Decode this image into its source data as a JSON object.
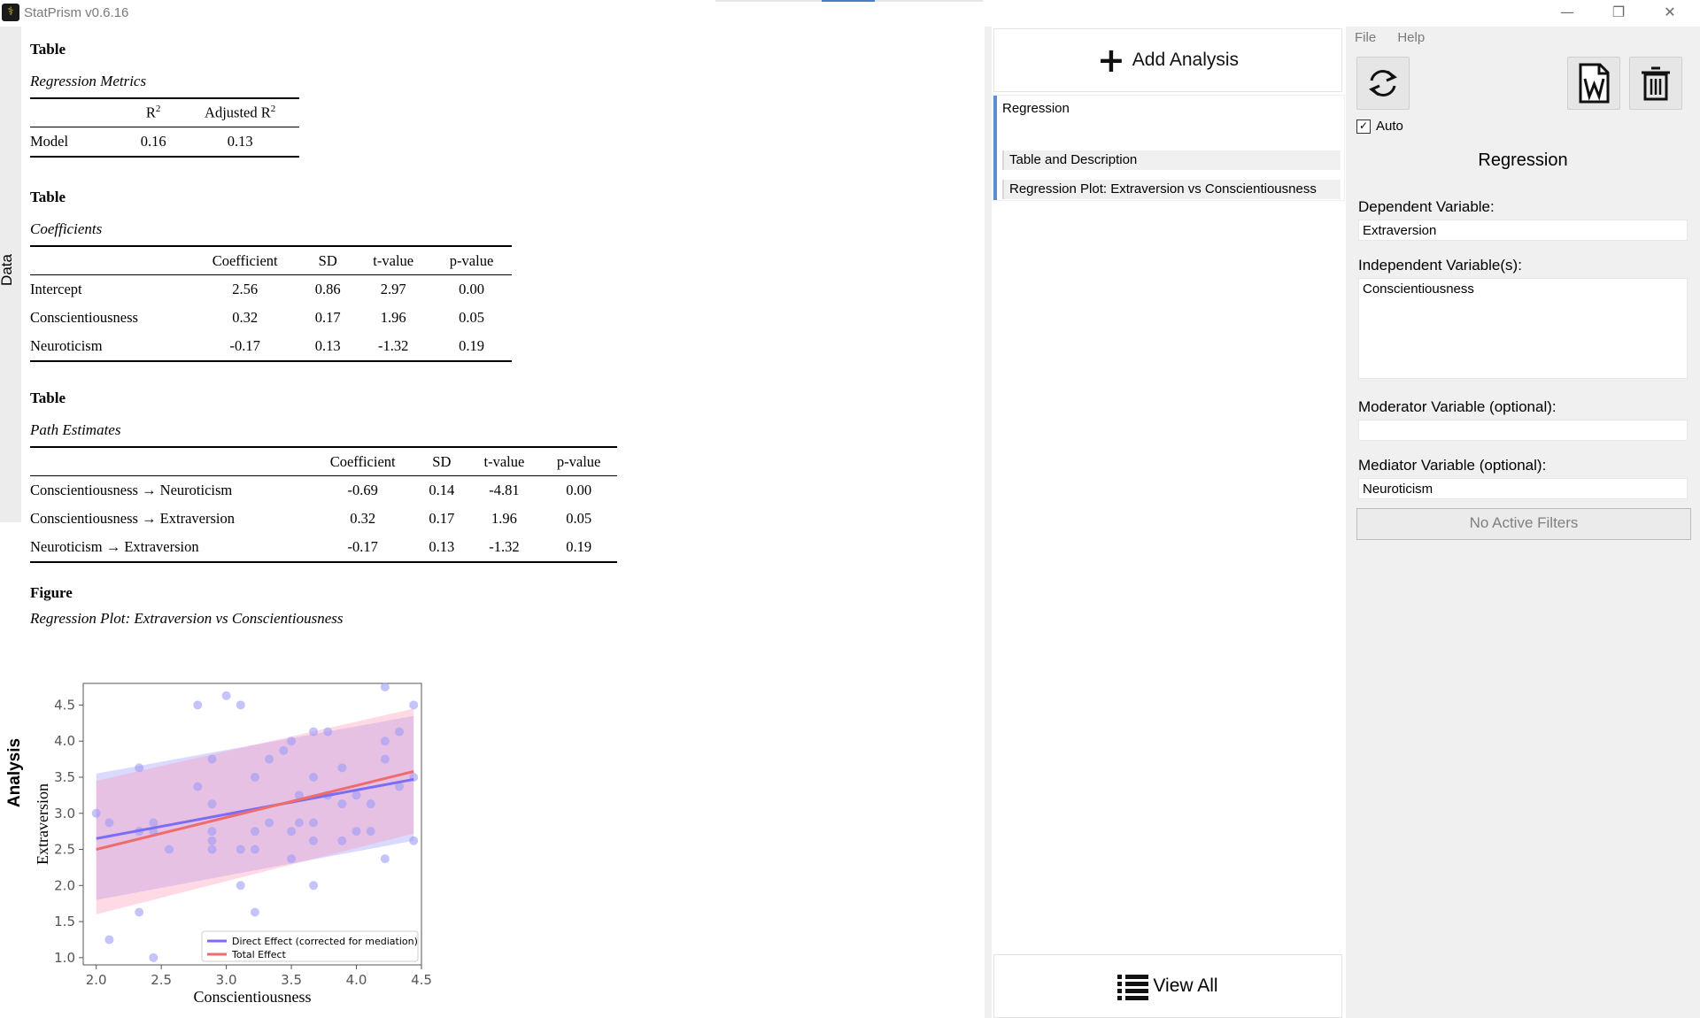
{
  "window": {
    "title": "StatPrism v0.6.16",
    "controls": {
      "minimize": "—",
      "restore": "❐",
      "close": "✕"
    },
    "progress_fraction": 0.2
  },
  "side_tabs": {
    "data": "Data",
    "analysis": "Analysis"
  },
  "report": {
    "table1": {
      "heading": "Table",
      "caption": "Regression Metrics",
      "row_label": "Model",
      "r2": "0.16",
      "adj_r2": "0.13",
      "col_r": "R",
      "col_adj": "Adjusted R",
      "sup": "2"
    },
    "table2": {
      "heading": "Table",
      "caption": "Coefficients",
      "columns": [
        "",
        "Coefficient",
        "SD",
        "t-value",
        "p-value"
      ],
      "rows": [
        [
          "Intercept",
          "2.56",
          "0.86",
          "2.97",
          "0.00"
        ],
        [
          "Conscientiousness",
          "0.32",
          "0.17",
          "1.96",
          "0.05"
        ],
        [
          "Neuroticism",
          "-0.17",
          "0.13",
          "-1.32",
          "0.19"
        ]
      ]
    },
    "table3": {
      "heading": "Table",
      "caption": "Path Estimates",
      "columns": [
        "",
        "Coefficient",
        "SD",
        "t-value",
        "p-value"
      ],
      "rows": [
        [
          "Conscientiousness → Neuroticism",
          "-0.69",
          "0.14",
          "-4.81",
          "0.00"
        ],
        [
          "Conscientiousness → Extraversion",
          "0.32",
          "0.17",
          "1.96",
          "0.05"
        ],
        [
          "Neuroticism → Extraversion",
          "-0.17",
          "0.13",
          "-1.32",
          "0.19"
        ]
      ]
    },
    "figure": {
      "heading": "Figure",
      "caption": "Regression Plot: Extraversion vs Conscientiousness"
    }
  },
  "chart_data": {
    "type": "scatter",
    "xlabel": "Conscientiousness",
    "ylabel": "Extraversion",
    "xlim": [
      1.9,
      4.5
    ],
    "ylim": [
      0.9,
      4.8
    ],
    "xticks": [
      "2.0",
      "2.5",
      "3.0",
      "3.5",
      "4.0",
      "4.5"
    ],
    "yticks": [
      "1.0",
      "1.5",
      "2.0",
      "2.5",
      "3.0",
      "3.5",
      "4.0",
      "4.5"
    ],
    "grid": false,
    "legend_position": "bottom-right",
    "points": [
      [
        2.0,
        3.0
      ],
      [
        2.1,
        2.87
      ],
      [
        2.1,
        1.25
      ],
      [
        2.33,
        3.63
      ],
      [
        2.33,
        2.75
      ],
      [
        2.33,
        1.63
      ],
      [
        2.44,
        2.87
      ],
      [
        2.44,
        2.75
      ],
      [
        2.44,
        1.0
      ],
      [
        2.56,
        2.5
      ],
      [
        2.78,
        3.37
      ],
      [
        2.78,
        4.5
      ],
      [
        2.89,
        3.75
      ],
      [
        2.89,
        3.13
      ],
      [
        2.89,
        2.75
      ],
      [
        2.89,
        2.62
      ],
      [
        2.89,
        2.5
      ],
      [
        3.0,
        4.63
      ],
      [
        3.11,
        4.5
      ],
      [
        3.11,
        2.5
      ],
      [
        3.11,
        2.0
      ],
      [
        3.22,
        3.5
      ],
      [
        3.22,
        2.75
      ],
      [
        3.22,
        2.5
      ],
      [
        3.22,
        1.63
      ],
      [
        3.33,
        3.75
      ],
      [
        3.33,
        2.87
      ],
      [
        3.44,
        3.87
      ],
      [
        3.5,
        4.0
      ],
      [
        3.5,
        2.75
      ],
      [
        3.5,
        2.37
      ],
      [
        3.56,
        3.25
      ],
      [
        3.56,
        2.87
      ],
      [
        3.67,
        4.13
      ],
      [
        3.67,
        3.5
      ],
      [
        3.67,
        2.87
      ],
      [
        3.67,
        2.62
      ],
      [
        3.67,
        2.0
      ],
      [
        3.78,
        4.13
      ],
      [
        3.78,
        3.25
      ],
      [
        3.89,
        3.63
      ],
      [
        3.89,
        3.13
      ],
      [
        3.89,
        2.62
      ],
      [
        4.0,
        3.25
      ],
      [
        4.0,
        2.75
      ],
      [
        4.11,
        3.13
      ],
      [
        4.11,
        2.75
      ],
      [
        4.22,
        4.75
      ],
      [
        4.22,
        4.0
      ],
      [
        4.22,
        3.75
      ],
      [
        4.22,
        2.37
      ],
      [
        4.33,
        4.13
      ],
      [
        4.33,
        3.37
      ],
      [
        4.44,
        4.5
      ],
      [
        4.44,
        3.5
      ],
      [
        4.44,
        2.62
      ]
    ],
    "series": [
      {
        "name": "Direct Effect (corrected for mediation)",
        "color": "#7b6cf6",
        "x": [
          2.0,
          4.44
        ],
        "y": [
          2.65,
          3.47
        ],
        "band_lower": [
          1.8,
          2.62
        ],
        "band_upper": [
          3.55,
          4.35
        ]
      },
      {
        "name": "Total Effect",
        "color": "#f06b6b",
        "x": [
          2.0,
          4.44
        ],
        "y": [
          2.5,
          3.58
        ],
        "band_lower": [
          1.6,
          2.72
        ],
        "band_upper": [
          3.45,
          4.45
        ]
      }
    ],
    "point_color": "#9d9bf7"
  },
  "analysis_list": {
    "add_label": "Add Analysis",
    "card_title": "Regression",
    "items": [
      "Table and Description",
      "Regression Plot: Extraversion vs Conscientiousness"
    ],
    "view_all_label": "View All"
  },
  "settings": {
    "menu": [
      "File",
      "Help"
    ],
    "auto_label": "Auto",
    "auto_checked": true,
    "title": "Regression",
    "dependent_label": "Dependent Variable:",
    "dependent_value": "Extraversion",
    "independent_label": "Independent Variable(s):",
    "independent_value": "Conscientiousness",
    "moderator_label": "Moderator Variable (optional):",
    "moderator_value": "",
    "mediator_label": "Mediator Variable (optional):",
    "mediator_value": "Neuroticism",
    "filters_label": "No Active Filters"
  }
}
